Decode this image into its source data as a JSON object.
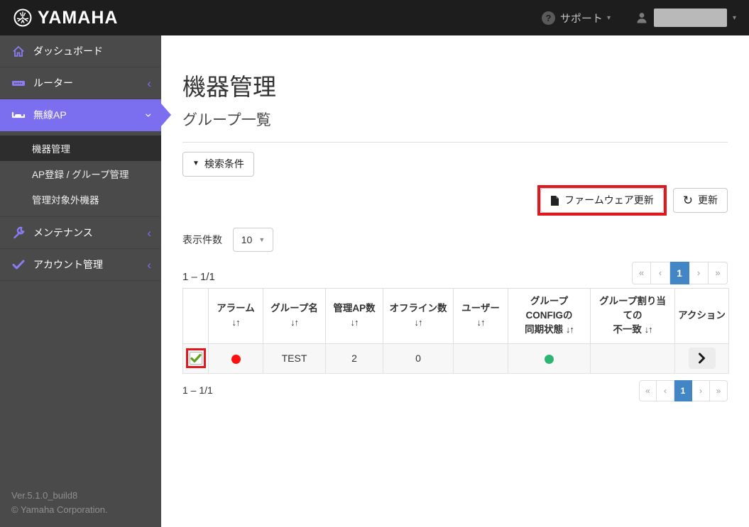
{
  "header": {
    "brand": "YAMAHA",
    "support": {
      "icon_glyph": "?",
      "label": "サポート",
      "caret": "▾"
    },
    "user": {
      "caret": "▾"
    }
  },
  "colors": {
    "accent_purple": "#7b6ff0",
    "topbar_bg": "#1d1d1d",
    "sidebar_bg": "#4a4a4a",
    "annotation_red": "#e0171c",
    "pagination_blue": "#4286c5",
    "alarm_red": "#ff1010",
    "sync_green": "#2eb573",
    "check_green": "#5ea01f"
  },
  "sidebar": {
    "items": [
      {
        "label": "ダッシュボード",
        "icon": "home-icon"
      },
      {
        "label": "ルーター",
        "icon": "router-icon",
        "chevron": "‹"
      },
      {
        "label": "無線AP",
        "icon": "access-point-icon",
        "chevron": "›",
        "active": true
      },
      {
        "label": "メンテナンス",
        "icon": "wrench-icon",
        "chevron": "‹"
      },
      {
        "label": "アカウント管理",
        "icon": "check-icon",
        "chevron": "‹"
      }
    ],
    "submenu": [
      {
        "label": "機器管理",
        "active": true
      },
      {
        "label": "AP登録 / グループ管理"
      },
      {
        "label": "管理対象外機器"
      }
    ],
    "footer": {
      "version": "Ver.5.1.0_build8",
      "copyright": "© Yamaha Corporation."
    }
  },
  "main": {
    "title": "機器管理",
    "subtitle": "グループ一覧",
    "search_button": {
      "caret": "▼",
      "label": "検索条件"
    },
    "firmware_button": {
      "label": "ファームウェア更新",
      "icon": "file-icon"
    },
    "refresh_button": {
      "label": "更新",
      "icon_glyph": "↻"
    },
    "page_size": {
      "label": "表示件数",
      "value": "10",
      "caret": "▼"
    },
    "range_text": "1 – 1/1",
    "range_text_bottom": "1 – 1/1",
    "pagination": {
      "first": "«",
      "prev": "‹",
      "page": "1",
      "next": "›",
      "last": "»"
    },
    "table": {
      "sort_icon": "↓↑",
      "headers": [
        {
          "label": ""
        },
        {
          "label": "アラーム\n",
          "sortable": true
        },
        {
          "label": "グループ名\n",
          "sortable": true
        },
        {
          "label": "管理AP数\n",
          "sortable": true
        },
        {
          "label": "オフライン数\n",
          "sortable": true
        },
        {
          "label": "ユーザー\n",
          "sortable": true
        },
        {
          "label": "グループ\nCONFIGの\n同期状態 ",
          "sortable": true
        },
        {
          "label": "グループ割り当\nての\n不一致 ",
          "sortable": true
        },
        {
          "label": "アクション"
        }
      ],
      "row": {
        "checkbox_checked": true,
        "alarm_status": "red-dot",
        "group_name": "TEST",
        "managed_ap_count": "2",
        "offline_count": "0",
        "user": "",
        "config_sync_status": "green-dot",
        "assignment_mismatch": "",
        "action": "chevron-right"
      }
    }
  }
}
